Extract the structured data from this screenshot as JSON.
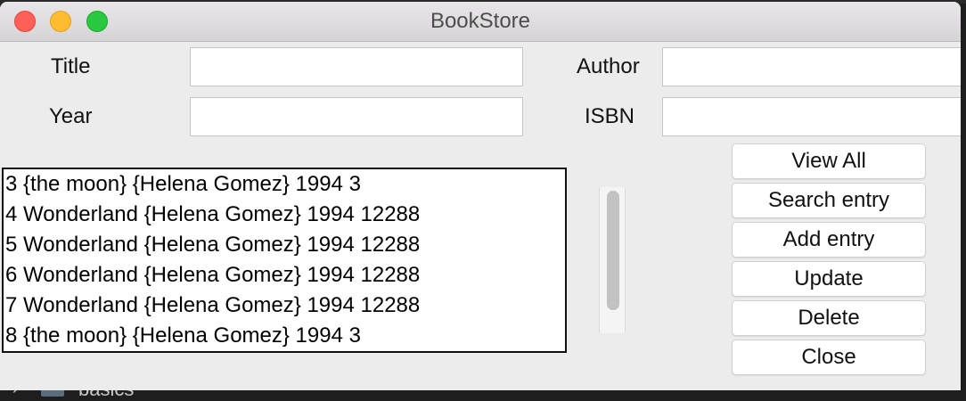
{
  "window": {
    "title": "BookStore"
  },
  "form": {
    "title_label": "Title",
    "author_label": "Author",
    "year_label": "Year",
    "isbn_label": "ISBN",
    "title_value": "",
    "author_value": "",
    "year_value": "",
    "isbn_value": ""
  },
  "listbox": {
    "rows": [
      "3 {the moon} {Helena Gomez} 1994 3",
      "4 Wonderland {Helena Gomez} 1994 12288",
      "5 Wonderland {Helena Gomez} 1994 12288",
      "6 Wonderland {Helena Gomez} 1994 12288",
      "7 Wonderland {Helena Gomez} 1994 12288",
      "8 {the moon} {Helena Gomez} 1994 3"
    ]
  },
  "buttons": {
    "view_all": "View All",
    "search": "Search entry",
    "add": "Add entry",
    "update": "Update",
    "delete": "Delete",
    "close": "Close"
  },
  "background": {
    "folder_label": "basics"
  }
}
